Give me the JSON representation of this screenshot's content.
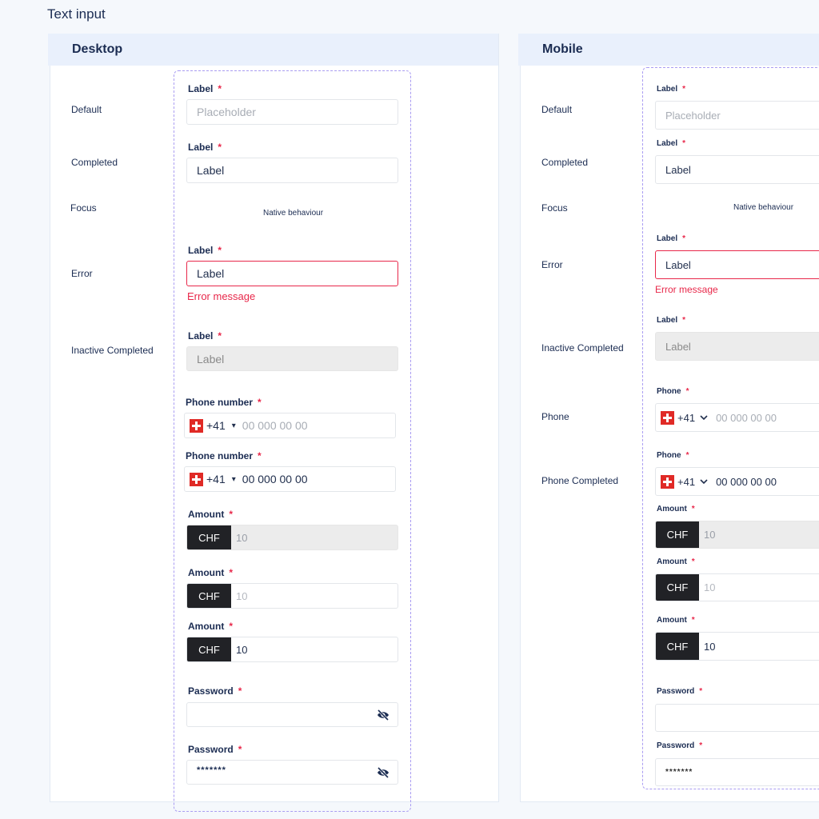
{
  "page": {
    "title": "Text input"
  },
  "colors": {
    "accent_dash": "#a99cf2",
    "error": "#e8284a",
    "text": "#1b2c52",
    "header_bg": "#e9f0fc",
    "chf_bg": "#212226"
  },
  "desktop": {
    "title": "Desktop",
    "rows": {
      "default": "Default",
      "completed": "Completed",
      "focus": "Focus",
      "error": "Error",
      "inactive": "Inactive Completed"
    },
    "fields": {
      "default": {
        "label": "Label",
        "required": "*",
        "placeholder": "Placeholder"
      },
      "completed": {
        "label": "Label",
        "required": "*",
        "value": "Label"
      },
      "focus": {
        "note": "Native behaviour"
      },
      "error": {
        "label": "Label",
        "required": "*",
        "value": "Label",
        "message": "Error message"
      },
      "inactive": {
        "label": "Label",
        "required": "*",
        "value": "Label"
      },
      "phone": {
        "label": "Phone number",
        "required": "*",
        "country_icon": "swiss-flag-icon",
        "code": "+41",
        "caret": "⌄",
        "placeholder": "00 000 00 00"
      },
      "phone_completed": {
        "label": "Phone number",
        "required": "*",
        "country_icon": "swiss-flag-icon",
        "code": "+41",
        "caret": "⌄",
        "value": "00 000 00 00"
      },
      "amount_inactive": {
        "label": "Amount",
        "required": "*",
        "currency": "CHF",
        "value": "10"
      },
      "amount_default": {
        "label": "Amount",
        "required": "*",
        "currency": "CHF",
        "placeholder": "10"
      },
      "amount_completed": {
        "label": "Amount",
        "required": "*",
        "currency": "CHF",
        "value": "10"
      },
      "password": {
        "label": "Password",
        "required": "*",
        "value": "",
        "icon": "eye-off-icon"
      },
      "password_completed": {
        "label": "Password",
        "required": "*",
        "value": "*******",
        "icon": "eye-off-icon"
      }
    }
  },
  "mobile": {
    "title": "Mobile",
    "rows": {
      "default": "Default",
      "completed": "Completed",
      "focus": "Focus",
      "error": "Error",
      "inactive": "Inactive Completed",
      "phone": "Phone",
      "phone_completed": "Phone Completed"
    },
    "fields": {
      "default": {
        "label": "Label",
        "required": "*",
        "placeholder": "Placeholder"
      },
      "completed": {
        "label": "Label",
        "required": "*",
        "value": "Label"
      },
      "focus": {
        "note": "Native behaviour"
      },
      "error": {
        "label": "Label",
        "required": "*",
        "value": "Label",
        "message": "Error message"
      },
      "inactive": {
        "label": "Label",
        "required": "*",
        "value": "Label"
      },
      "phone": {
        "label": "Phone",
        "required": "*",
        "country_icon": "swiss-flag-icon",
        "code": "+41",
        "placeholder": "00 000 00 00"
      },
      "phone_completed": {
        "label": "Phone",
        "required": "*",
        "country_icon": "swiss-flag-icon",
        "code": "+41",
        "value": "00 000 00 00"
      },
      "amount_inactive": {
        "label": "Amount",
        "required": "*",
        "currency": "CHF",
        "value": "10"
      },
      "amount_default": {
        "label": "Amount",
        "required": "*",
        "currency": "CHF",
        "placeholder": "10"
      },
      "amount_completed": {
        "label": "Amount",
        "required": "*",
        "currency": "CHF",
        "value": "10"
      },
      "password": {
        "label": "Password",
        "required": "*",
        "value": ""
      },
      "password_completed": {
        "label": "Password",
        "required": "*",
        "value": "*******"
      }
    }
  }
}
